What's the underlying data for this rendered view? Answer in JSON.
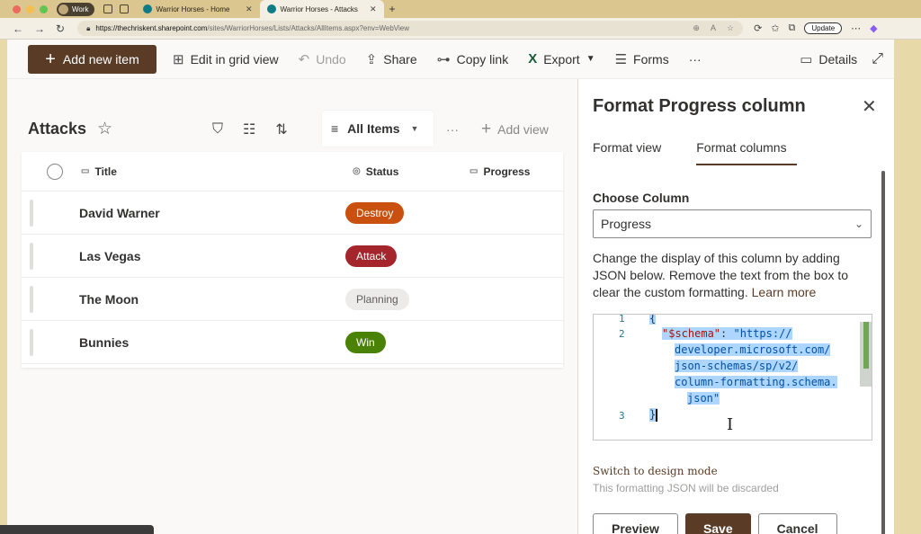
{
  "browser": {
    "profile_label": "Work",
    "tabs": [
      {
        "title": "Warrior Horses - Home"
      },
      {
        "title": "Warrior Horses - Attacks"
      }
    ],
    "url_host": "https://thechriskent.sharepoint.com",
    "url_path": "/sites/WarriorHorses/Lists/Attacks/AllItems.aspx?env=WebView",
    "update_label": "Update"
  },
  "commandbar": {
    "add_new_item": "Add new item",
    "edit_grid": "Edit in grid view",
    "undo": "Undo",
    "share": "Share",
    "copy_link": "Copy link",
    "export": "Export",
    "forms": "Forms",
    "more": "···",
    "details": "Details"
  },
  "list": {
    "title": "Attacks",
    "view_name": "All Items",
    "add_view": "Add view",
    "more": "···",
    "columns": {
      "title": "Title",
      "status": "Status",
      "progress": "Progress"
    },
    "rows": [
      {
        "title": "David Warner",
        "status": "Destroy",
        "status_bg": "#ca5010",
        "status_fg": "#ffffff"
      },
      {
        "title": "Las Vegas",
        "status": "Attack",
        "status_bg": "#a4262c",
        "status_fg": "#ffffff"
      },
      {
        "title": "The Moon",
        "status": "Planning",
        "status_bg": "#edebe9",
        "status_fg": "#605e5c"
      },
      {
        "title": "Bunnies",
        "status": "Win",
        "status_bg": "#498205",
        "status_fg": "#ffffff"
      }
    ]
  },
  "panel": {
    "title": "Format Progress column",
    "tabs": [
      "Format view",
      "Format columns"
    ],
    "choose_column_label": "Choose Column",
    "selected_column": "Progress",
    "description": "Change the display of this column by adding JSON below. Remove the text from the box to clear the custom formatting.",
    "learn_more": "Learn more",
    "editor": {
      "line_numbers": [
        "1",
        "2",
        "3"
      ],
      "line1": "{",
      "schema_key": "\"$schema\"",
      "colon": ":",
      "schema_value_lines": [
        "\"https://",
        "developer.microsoft.com/",
        "json-schemas/sp/v2/",
        "column-formatting.schema.",
        "json\""
      ],
      "line3": "}"
    },
    "switch_design_mode": "Switch to design mode",
    "discard_note": "This formatting JSON will be discarded",
    "buttons": {
      "preview": "Preview",
      "save": "Save",
      "cancel": "Cancel"
    }
  },
  "colors": {
    "accent": "#5a3b26",
    "browser_chrome": "#dcc690"
  }
}
